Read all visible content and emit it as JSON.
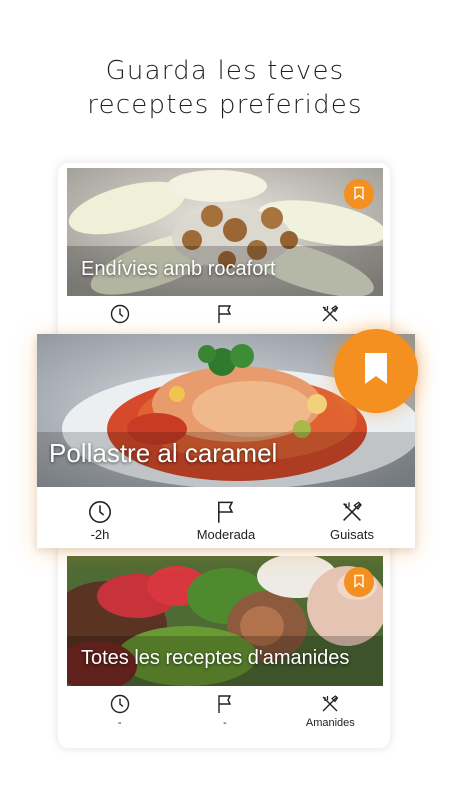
{
  "headline": {
    "line1": "Guarda les teves",
    "line2": "receptes preferides"
  },
  "colors": {
    "accent": "#f4901f",
    "text": "#222222"
  },
  "cards": [
    {
      "title": "Endívies amb rocafort",
      "time": "",
      "difficulty": "",
      "category": ""
    },
    {
      "title": "Pollastre al caramel",
      "time": "-2h",
      "difficulty": "Moderada",
      "category": "Guisats"
    },
    {
      "title": "Totes les receptes d'amanides",
      "time": "-",
      "difficulty": "-",
      "category": "Amanides"
    }
  ],
  "icons": {
    "time": "clock-icon",
    "difficulty": "flag-icon",
    "category": "cutlery-icon",
    "save": "bookmark-icon"
  }
}
